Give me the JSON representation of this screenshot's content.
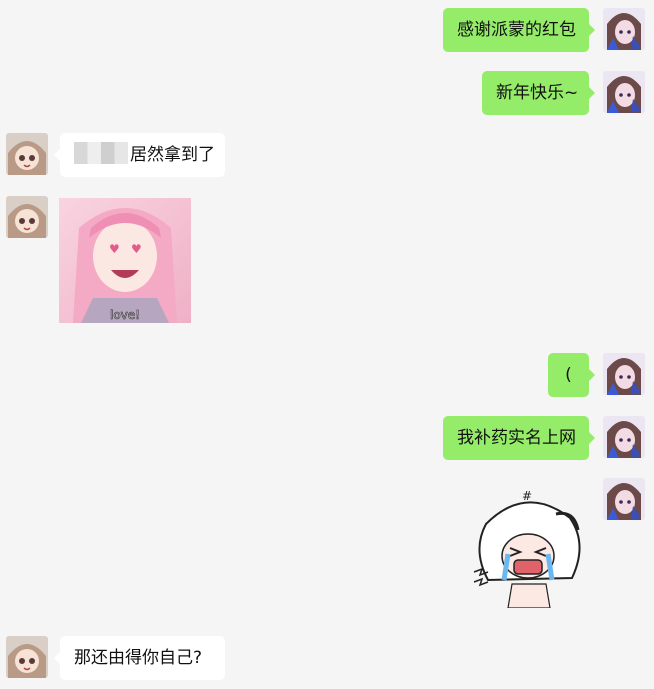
{
  "messages": [
    {
      "side": "right",
      "text": "感谢派蒙的红包"
    },
    {
      "side": "right",
      "text": "新年快乐~"
    },
    {
      "side": "left",
      "text": "居然拿到了",
      "redacted_prefix": true
    },
    {
      "side": "left",
      "type": "sticker",
      "caption": "love!"
    },
    {
      "side": "right",
      "text": "("
    },
    {
      "side": "right",
      "text": "我补药实名上网"
    },
    {
      "side": "right",
      "type": "sticker"
    },
    {
      "side": "left",
      "text": "那还由得你自己?"
    }
  ],
  "colors": {
    "background": "#f5f5f5",
    "sent_bubble": "#95ec69",
    "received_bubble": "#ffffff"
  }
}
